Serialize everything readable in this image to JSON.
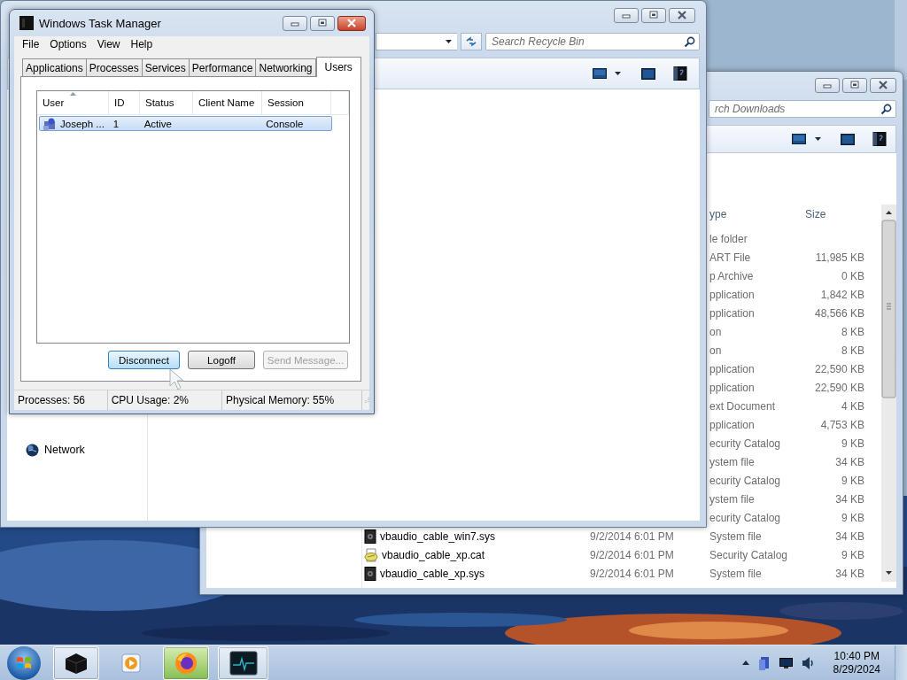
{
  "downloads_window": {
    "search": {
      "placeholder": "rch Downloads"
    },
    "columns": [
      "ype",
      "Size"
    ],
    "rows": [
      {
        "type": "le folder"
      },
      {
        "type": "ART File",
        "size": "11,985 KB"
      },
      {
        "type": "p Archive",
        "size": "0 KB"
      },
      {
        "type": "pplication",
        "size": "1,842 KB"
      },
      {
        "type": "pplication",
        "size": "48,566 KB"
      },
      {
        "type": "on",
        "size": "8 KB"
      },
      {
        "type": "on",
        "size": "8 KB"
      },
      {
        "type": "pplication",
        "size": "22,590 KB"
      },
      {
        "type": "pplication",
        "size": "22,590 KB"
      },
      {
        "type": "ext Document",
        "size": "4 KB"
      },
      {
        "type": "pplication",
        "size": "4,753 KB"
      },
      {
        "type": "ecurity Catalog",
        "size": "9 KB"
      },
      {
        "type": "ystem file",
        "size": "34 KB"
      },
      {
        "type": "ecurity Catalog",
        "size": "9 KB"
      },
      {
        "type": "ystem file",
        "size": "34 KB"
      },
      {
        "type": "ecurity Catalog",
        "size": "9 KB"
      },
      {
        "kind": "sys",
        "name": "vbaudio_cable_win7.sys",
        "date_modified": "9/2/2014 6:01 PM",
        "type": "System file",
        "size": "34 KB"
      },
      {
        "kind": "cat",
        "name": "vbaudio_cable_xp.cat",
        "date_modified": "9/2/2014 6:01 PM",
        "type": "Security Catalog",
        "size": "9 KB"
      },
      {
        "kind": "sys",
        "name": "vbaudio_cable_xp.sys",
        "date_modified": "9/2/2014 6:01 PM",
        "type": "System file",
        "size": "34 KB"
      }
    ]
  },
  "recycle_bin_window": {
    "search": {
      "placeholder": "Search Recycle Bin"
    },
    "nav_items": [
      {
        "label": "Network"
      }
    ]
  },
  "task_manager": {
    "title": "Windows Task Manager",
    "menu": [
      "File",
      "Options",
      "View",
      "Help"
    ],
    "tabs": [
      {
        "label": "Applications",
        "selected": false
      },
      {
        "label": "Processes",
        "selected": false
      },
      {
        "label": "Services",
        "selected": false
      },
      {
        "label": "Performance",
        "selected": false
      },
      {
        "label": "Networking",
        "selected": false
      },
      {
        "label": "Users",
        "selected": true
      }
    ],
    "columns": [
      {
        "label": "User",
        "sorted": true
      },
      {
        "label": "ID",
        "sorted": false
      },
      {
        "label": "Status",
        "sorted": false
      },
      {
        "label": "Client Name",
        "sorted": false
      },
      {
        "label": "Session",
        "sorted": false
      }
    ],
    "rows": [
      {
        "user": "Joseph ...",
        "id": "1",
        "status": "Active",
        "session": "Console",
        "selected": true
      }
    ],
    "buttons": [
      {
        "label": "Disconnect",
        "hovered": true,
        "disabled": false
      },
      {
        "label": "Logoff",
        "hovered": false,
        "disabled": false
      },
      {
        "label": "Send Message...",
        "hovered": false,
        "disabled": true
      }
    ],
    "status_bar": [
      "Processes: 56",
      "CPU Usage: 2%",
      "Physical Memory: 55%"
    ]
  },
  "taskbar": {
    "apps": [
      {
        "kind": "box",
        "open": true
      },
      {
        "kind": "media",
        "open": false
      },
      {
        "kind": "browser",
        "open": true
      },
      {
        "kind": "monitor",
        "open": true
      }
    ],
    "clock": {
      "time": "10:40 PM",
      "date": "8/29/2024"
    }
  }
}
